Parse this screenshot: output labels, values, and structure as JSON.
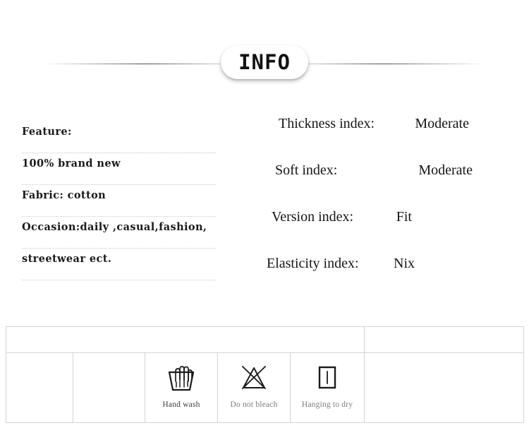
{
  "banner": {
    "title": "INFO"
  },
  "features": {
    "rows": [
      {
        "text": "Feature:"
      },
      {
        "text": "100% brand new"
      },
      {
        "text": "Fabric: cotton"
      },
      {
        "text": "Occasion:daily ,casual,fashion,"
      },
      {
        "text": "streetwear ect."
      }
    ]
  },
  "indices": {
    "rows": [
      {
        "label": "Thickness index:",
        "value": "Moderate"
      },
      {
        "label": "Soft index:",
        "value": "Moderate"
      },
      {
        "label": "Version index:",
        "value": "Fit"
      },
      {
        "label": "Elasticity index:",
        "value": "Nix"
      }
    ]
  },
  "care": {
    "cells": [
      {
        "label": "",
        "icon": ""
      },
      {
        "label": "",
        "icon": ""
      },
      {
        "label": "Hand wash",
        "icon": "hand-wash-icon"
      },
      {
        "label": "Do not bleach",
        "icon": "do-not-bleach-icon"
      },
      {
        "label": "Hanging to dry",
        "icon": "hanging-to-dry-icon"
      },
      {
        "label": "",
        "icon": ""
      }
    ]
  },
  "colors": {
    "text": "#151515",
    "muted": "#7b7b7b",
    "rule": "#c9c9c9",
    "table_border": "#d4d4d4",
    "background": "#ffffff"
  }
}
